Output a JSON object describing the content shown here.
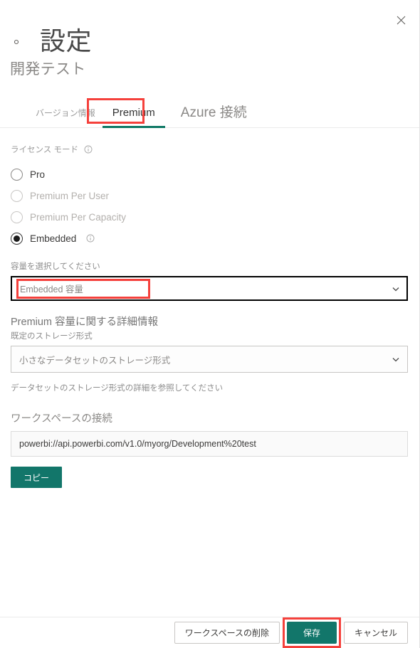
{
  "window": {
    "close_label": "×"
  },
  "header": {
    "gear_icon": "gear-icon",
    "title": "設定",
    "subtitle": "開発テスト"
  },
  "tabs": [
    {
      "label": "バージョン情報",
      "active": false
    },
    {
      "label": "Premium",
      "active": true
    },
    {
      "label": "Azure 接続",
      "active": false
    }
  ],
  "license": {
    "label": "ライセンス モード",
    "info_icon": "info-icon",
    "options": [
      {
        "label": "Pro",
        "checked": false,
        "disabled": false,
        "info": false
      },
      {
        "label": "Premium Per User",
        "checked": false,
        "disabled": true,
        "info": false
      },
      {
        "label": "Premium Per Capacity",
        "checked": false,
        "disabled": true,
        "info": false
      },
      {
        "label": "Embedded",
        "checked": true,
        "disabled": false,
        "info": true
      }
    ]
  },
  "capacity": {
    "label": "容量を選択してください",
    "placeholder": "Embedded 容量",
    "chevron_icon": "chevron-down-icon"
  },
  "premium_details": {
    "heading": "Premium 容量に関する詳細情報",
    "storage_label": "既定のストレージ形式",
    "storage_value": "小さなデータセットのストレージ形式",
    "chevron_icon": "chevron-down-icon",
    "hint": "データセットのストレージ形式の詳細を参照してください"
  },
  "workspace": {
    "heading": "ワークスペースの接続",
    "connection_url": "powerbi://api.powerbi.com/v1.0/myorg/Development%20test",
    "copy_label": "コピー"
  },
  "footer": {
    "delete_label": "ワークスペースの削除",
    "save_label": "保存",
    "cancel_label": "キャンセル"
  },
  "colors": {
    "accent_teal": "#12766a",
    "annotation_red": "#f5413c",
    "tab_underline": "#0d7764"
  }
}
